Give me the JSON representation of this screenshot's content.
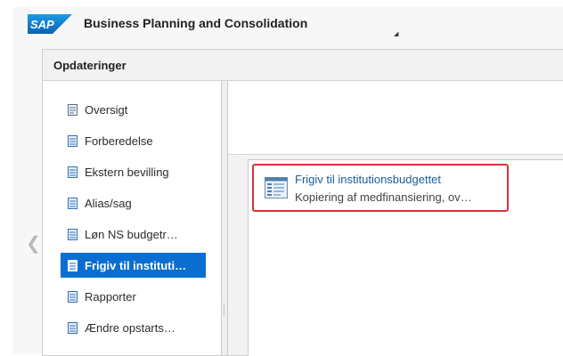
{
  "app": {
    "logo_text": "SAP",
    "title": "Business Planning and Consolidation",
    "title_dropdown_icon": "triangle-down-icon",
    "back_icon": "chevron-left-icon"
  },
  "panel": {
    "title": "Opdateringer"
  },
  "sidebar": {
    "items": [
      {
        "label": "Oversigt",
        "icon": "overview-icon",
        "active": false
      },
      {
        "label": "Forberedelse",
        "icon": "document-icon",
        "active": false
      },
      {
        "label": "Ekstern bevilling",
        "icon": "document-icon",
        "active": false
      },
      {
        "label": "Alias/sag",
        "icon": "document-icon",
        "active": false
      },
      {
        "label": "Løn NS budgetr…",
        "icon": "document-icon",
        "active": false
      },
      {
        "label": "Frigiv til instituti…",
        "icon": "document-icon",
        "active": true
      },
      {
        "label": "Rapporter",
        "icon": "document-icon",
        "active": false
      },
      {
        "label": "Ændre opstarts…",
        "icon": "document-icon",
        "active": false
      }
    ]
  },
  "tile": {
    "title": "Frigiv til institutionsbudgettet",
    "description": "Kopiering af medfinansiering, ov…",
    "icon": "form-icon"
  },
  "colors": {
    "accent": "#0a6ed1",
    "highlight": "#d6333a",
    "link": "#1b5d9c"
  }
}
